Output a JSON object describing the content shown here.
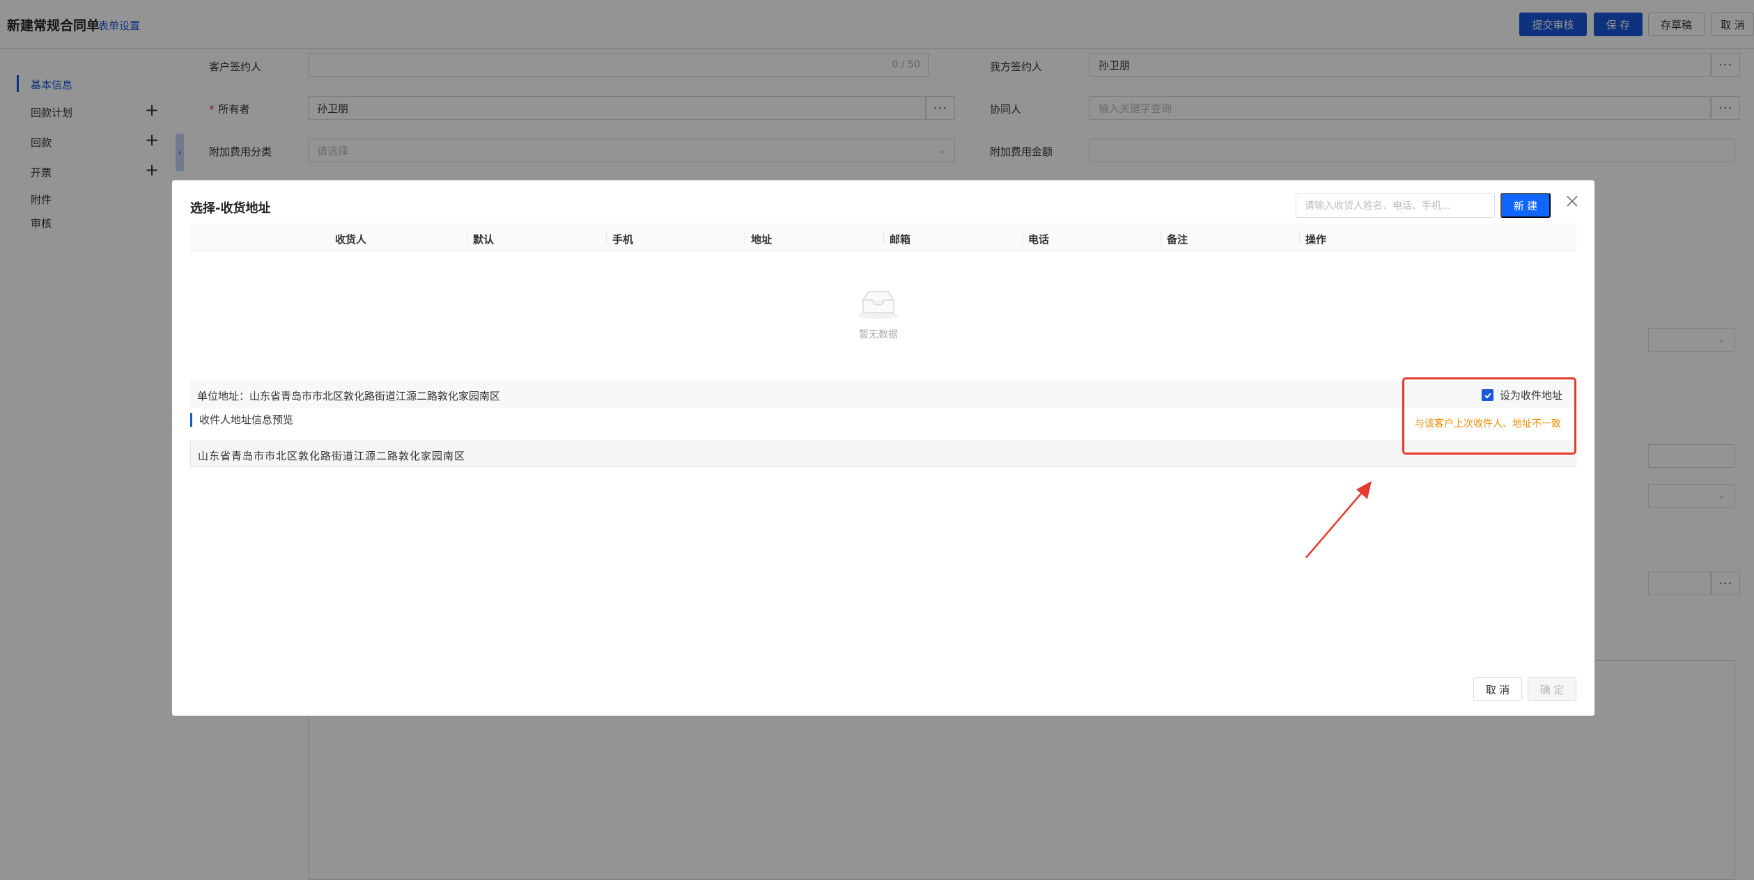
{
  "header": {
    "title": "新建常规合同单",
    "form_settings": "表单设置",
    "buttons": {
      "submit_review": "提交审核",
      "save": "保 存",
      "draft": "存草稿",
      "cancel": "取 消"
    }
  },
  "sidebar": {
    "items": [
      {
        "label": "基本信息",
        "active": true,
        "has_add": false
      },
      {
        "label": "回款计划",
        "active": false,
        "has_add": true
      },
      {
        "label": "回款",
        "active": false,
        "has_add": true
      },
      {
        "label": "开票",
        "active": false,
        "has_add": true
      },
      {
        "label": "附件",
        "active": false,
        "has_add": false
      },
      {
        "label": "审核",
        "active": false,
        "has_add": false
      }
    ],
    "add_symbol": "+"
  },
  "form": {
    "customer_signer": {
      "label": "客户签约人",
      "counter": "0 / 50"
    },
    "our_signer": {
      "label": "我方签约人",
      "value": "孙卫朋"
    },
    "owner": {
      "label": "所有者",
      "required_mark": "*",
      "value": "孙卫朋"
    },
    "collaborator": {
      "label": "协同人",
      "placeholder": "输入关键字查询"
    },
    "extra_fee_category": {
      "label": "附加费用分类",
      "placeholder": "请选择"
    },
    "extra_fee_amount": {
      "label": "附加费用金额"
    },
    "more_symbol": "···"
  },
  "modal": {
    "title": "选择-收货地址",
    "search_placeholder": "请输入收货人姓名、电话、手机...",
    "new_button": "新 建",
    "columns": [
      "收货人",
      "默认",
      "手机",
      "地址",
      "邮箱",
      "电话",
      "备注",
      "操作"
    ],
    "empty_text": "暂无数据",
    "unit_address": "单位地址：山东省青岛市市北区敦化路街道江源二路敦化家园南区",
    "preview_title": "收件人地址信息预览",
    "preview_address": "山东省青岛市市北区敦化路街道江源二路敦化家园南区",
    "set_receiving": {
      "label": "设为收件地址",
      "checked": true
    },
    "warning": "与该客户上次收件人、地址不一致",
    "cancel_button": "取 消",
    "ok_button": "确 定"
  },
  "colors": {
    "primary": "#1a56db",
    "new_button": "#0f66ff",
    "warning": "#f08c00",
    "highlight": "#e53a2c",
    "required": "#e03a3a"
  }
}
